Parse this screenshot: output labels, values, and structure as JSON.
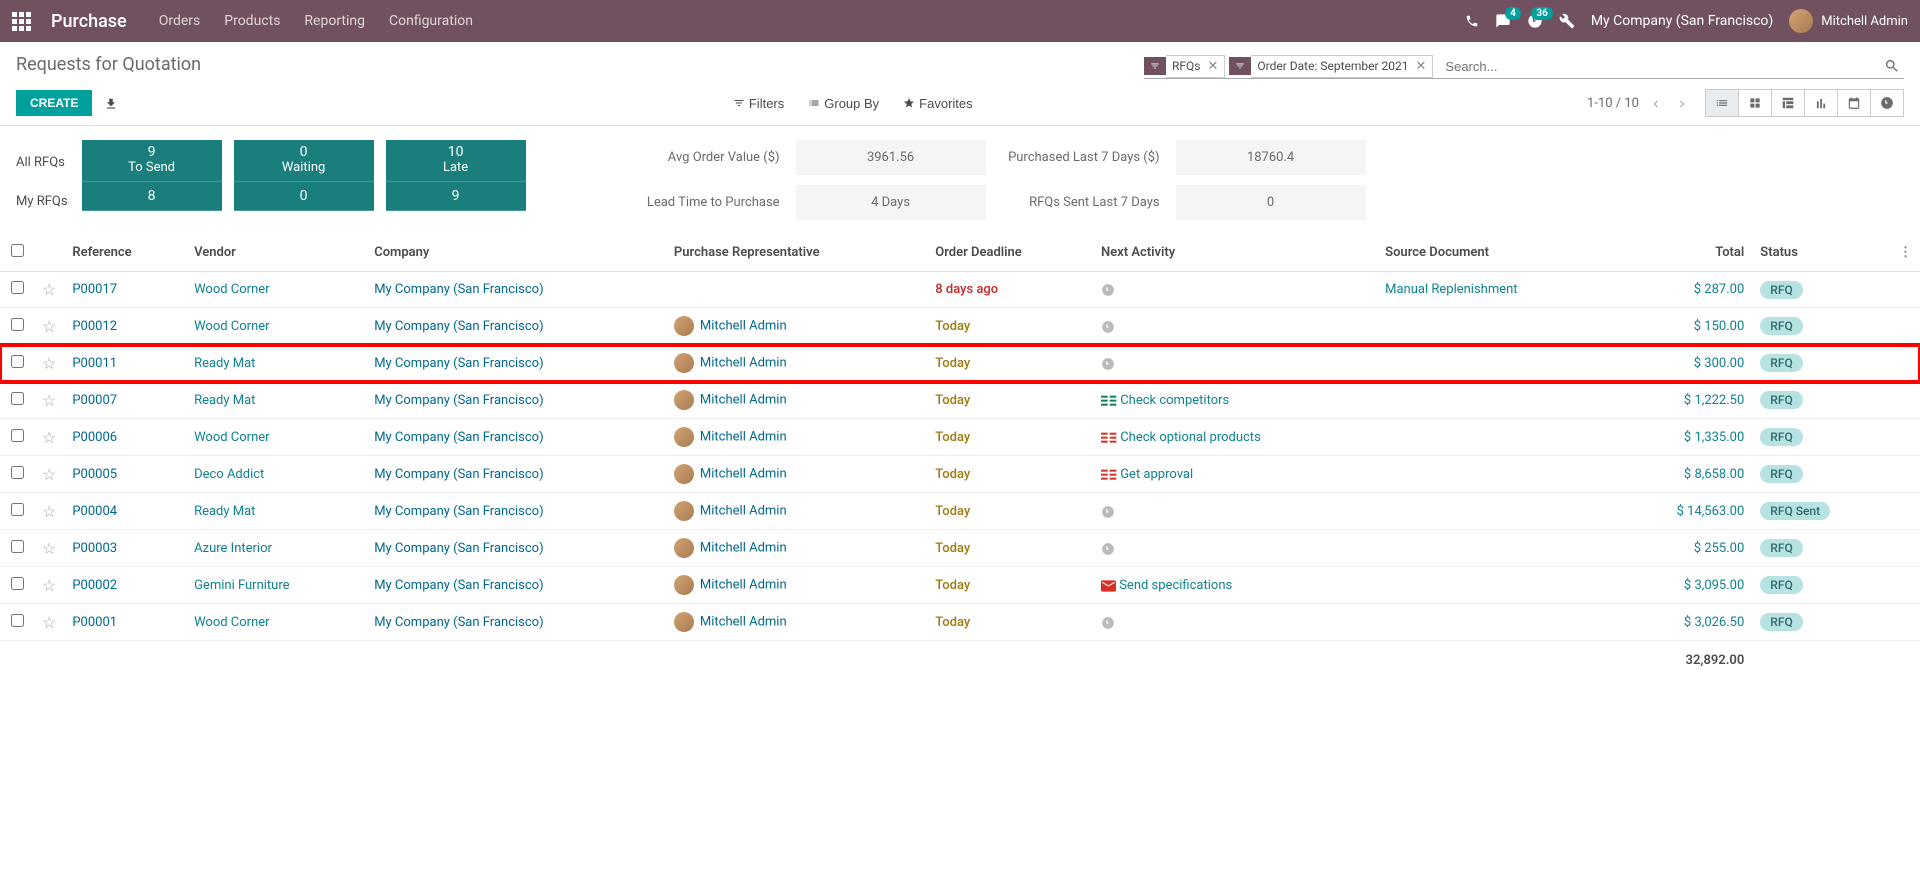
{
  "topnav": {
    "brand": "Purchase",
    "menu": [
      "Orders",
      "Products",
      "Reporting",
      "Configuration"
    ],
    "msg_badge": "4",
    "activity_badge": "36",
    "company": "My Company (San Francisco)",
    "user": "Mitchell Admin"
  },
  "page": {
    "title": "Requests for Quotation",
    "facets": [
      {
        "label": "RFQs"
      },
      {
        "label": "Order Date: September 2021"
      }
    ],
    "search_placeholder": "Search...",
    "create_btn": "CREATE",
    "filters_btn": "Filters",
    "groupby_btn": "Group By",
    "favorites_btn": "Favorites",
    "pager": "1-10 / 10"
  },
  "dashboard": {
    "rows": [
      "All RFQs",
      "My RFQs"
    ],
    "cols": [
      "To Send",
      "Waiting",
      "Late"
    ],
    "all": [
      "9",
      "0",
      "10"
    ],
    "my": [
      "8",
      "0",
      "9"
    ],
    "metrics": {
      "avg_label": "Avg Order Value ($)",
      "avg_value": "3961.56",
      "lead_label": "Lead Time to Purchase",
      "lead_value": "4  Days",
      "purch_label": "Purchased Last 7 Days ($)",
      "purch_value": "18760.4",
      "sent_label": "RFQs Sent Last 7 Days",
      "sent_value": "0"
    }
  },
  "table": {
    "columns": [
      "Reference",
      "Vendor",
      "Company",
      "Purchase Representative",
      "Order Deadline",
      "Next Activity",
      "Source Document",
      "Total",
      "Status"
    ],
    "rows": [
      {
        "ref": "P00017",
        "vendor": "Wood Corner",
        "company": "My Company (San Francisco)",
        "rep": "",
        "deadline": "8 days ago",
        "deadline_class": "late",
        "activity": "",
        "activity_type": "clock",
        "source": "Manual Replenishment",
        "total": "$ 287.00",
        "status": "RFQ",
        "highlight": false
      },
      {
        "ref": "P00012",
        "vendor": "Wood Corner",
        "company": "My Company (San Francisco)",
        "rep": "Mitchell Admin",
        "deadline": "Today",
        "deadline_class": "today",
        "activity": "",
        "activity_type": "clock",
        "source": "",
        "total": "$ 150.00",
        "status": "RFQ",
        "highlight": false
      },
      {
        "ref": "P00011",
        "vendor": "Ready Mat",
        "company": "My Company (San Francisco)",
        "rep": "Mitchell Admin",
        "deadline": "Today",
        "deadline_class": "today",
        "activity": "",
        "activity_type": "clock",
        "source": "",
        "total": "$ 300.00",
        "status": "RFQ",
        "highlight": true
      },
      {
        "ref": "P00007",
        "vendor": "Ready Mat",
        "company": "My Company (San Francisco)",
        "rep": "Mitchell Admin",
        "deadline": "Today",
        "deadline_class": "today",
        "activity": "Check competitors",
        "activity_type": "green",
        "source": "",
        "total": "$ 1,222.50",
        "status": "RFQ",
        "highlight": false
      },
      {
        "ref": "P00006",
        "vendor": "Wood Corner",
        "company": "My Company (San Francisco)",
        "rep": "Mitchell Admin",
        "deadline": "Today",
        "deadline_class": "today",
        "activity": "Check optional products",
        "activity_type": "red",
        "source": "",
        "total": "$ 1,335.00",
        "status": "RFQ",
        "highlight": false
      },
      {
        "ref": "P00005",
        "vendor": "Deco Addict",
        "company": "My Company (San Francisco)",
        "rep": "Mitchell Admin",
        "deadline": "Today",
        "deadline_class": "today",
        "activity": "Get approval",
        "activity_type": "red",
        "source": "",
        "total": "$ 8,658.00",
        "status": "RFQ",
        "highlight": false
      },
      {
        "ref": "P00004",
        "vendor": "Ready Mat",
        "company": "My Company (San Francisco)",
        "rep": "Mitchell Admin",
        "deadline": "Today",
        "deadline_class": "today",
        "activity": "",
        "activity_type": "clock",
        "source": "",
        "total": "$ 14,563.00",
        "status": "RFQ Sent",
        "highlight": false
      },
      {
        "ref": "P00003",
        "vendor": "Azure Interior",
        "company": "My Company (San Francisco)",
        "rep": "Mitchell Admin",
        "deadline": "Today",
        "deadline_class": "today",
        "activity": "",
        "activity_type": "clock",
        "source": "",
        "total": "$ 255.00",
        "status": "RFQ",
        "highlight": false
      },
      {
        "ref": "P00002",
        "vendor": "Gemini Furniture",
        "company": "My Company (San Francisco)",
        "rep": "Mitchell Admin",
        "deadline": "Today",
        "deadline_class": "today",
        "activity": "Send specifications",
        "activity_type": "mail",
        "source": "",
        "total": "$ 3,095.00",
        "status": "RFQ",
        "highlight": false
      },
      {
        "ref": "P00001",
        "vendor": "Wood Corner",
        "company": "My Company (San Francisco)",
        "rep": "Mitchell Admin",
        "deadline": "Today",
        "deadline_class": "today",
        "activity": "",
        "activity_type": "clock",
        "source": "",
        "total": "$ 3,026.50",
        "status": "RFQ",
        "highlight": false
      }
    ],
    "total": "32,892.00"
  }
}
